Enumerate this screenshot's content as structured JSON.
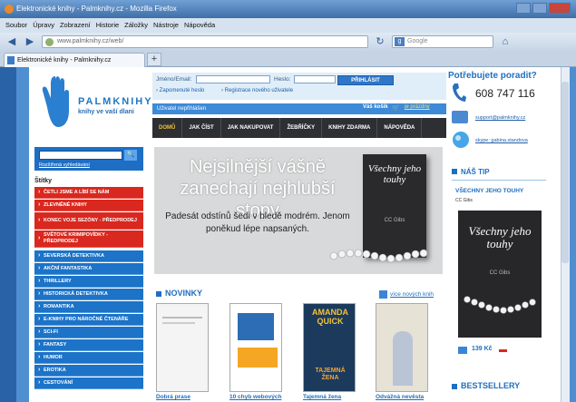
{
  "window": {
    "title": "Elektronické knihy - Palmknihy.cz - Mozilla Firefox"
  },
  "menu": [
    "Soubor",
    "Úpravy",
    "Zobrazení",
    "Historie",
    "Záložky",
    "Nástroje",
    "Nápověda"
  ],
  "navbar": {
    "url": "www.palmknihy.cz/web/",
    "search_placeholder": "Google"
  },
  "tab": {
    "label": "Elektronické knihy - Palmknihy.cz",
    "new_tab": "+"
  },
  "logo": {
    "name": "PALMKNIHY",
    "tagline": "knihy ve vaší dlani"
  },
  "login": {
    "email_label": "Jméno/Email:",
    "password_label": "Heslo:",
    "button": "PŘIHLÁSIT",
    "forgot": "Zapomenuté heslo",
    "register": "Registrace nového uživatele"
  },
  "userbar": {
    "status": "Uživatel nepřihlášen",
    "cart": "Váš košík",
    "cart_link": "je prázdný"
  },
  "nav": [
    "DOMŮ",
    "JAK ČÍST",
    "JAK NAKUPOVAT",
    "ŽEBŘÍČKY",
    "KNIHY ZDARMA",
    "NÁPOVĚDA"
  ],
  "sidebar": {
    "search_button": "🔍",
    "advanced_search": "Rozšířená vyhledávání",
    "tags_title": "Štítky",
    "categories": [
      {
        "label": "ČETLI JSME A LÍBÍ SE NÁM",
        "color": "red"
      },
      {
        "label": "ZLEVNĚNÉ KNIHY",
        "color": "red"
      },
      {
        "label": "KONEC VOJE SEZÓNY - PŘEDPRODEJ",
        "color": "red"
      },
      {
        "label": "SVĚTOVÉ KRIMIPOVÍDKY - PŘEDPRODEJ",
        "color": "red"
      },
      {
        "label": "SEVERSKÁ DETEKTIVKA",
        "color": "blue"
      },
      {
        "label": "AKČNÍ FANTASTIKA",
        "color": "blue"
      },
      {
        "label": "THRILLERY",
        "color": "blue"
      },
      {
        "label": "HISTORICKÁ DETEKTIVKA",
        "color": "blue"
      },
      {
        "label": "ROMANTIKA",
        "color": "blue"
      },
      {
        "label": "E-KNIHY PRO NÁROČNÉ ČTENÁŘE",
        "color": "blue"
      },
      {
        "label": "SCI-FI",
        "color": "blue"
      },
      {
        "label": "FANTASY",
        "color": "blue"
      },
      {
        "label": "HUMOR",
        "color": "blue"
      },
      {
        "label": "EROTIKA",
        "color": "blue"
      },
      {
        "label": "CESTOVÁNÍ",
        "color": "blue"
      }
    ]
  },
  "banner": {
    "headline": "Nejsilnější vášně zanechají nejhlubší stopy",
    "subtitle": "Padesát odstínů šedi v bledě modrém. Jenom poněkud lépe napsaných.",
    "book_title": "Všechny jeho touhy",
    "book_author": "CC Gibs"
  },
  "novinky": {
    "title": "NOVINKY",
    "more": "více nových knih",
    "books": [
      {
        "title": "Dobrá prase"
      },
      {
        "title": "10 chyb webových"
      },
      {
        "title": "Tajemná žena",
        "cover_top": "AMANDA QUICK",
        "cover_bottom": "TAJEMNÁ ŽENA"
      },
      {
        "title": "Odvážná nevěsta"
      }
    ]
  },
  "help": {
    "title": "Potřebujete poradit?",
    "phone": "608 747 116",
    "email": "support@palmknihy.cz",
    "skype": "skype: gabina.standova"
  },
  "tip": {
    "title": "NÁŠ TIP",
    "book_title": "VŠECHNY JEHO TOUHY",
    "author": "CC Gibs",
    "cover_title": "Všechny jeho touhy",
    "cover_author": "CC Gibs",
    "price": "139 Kč"
  },
  "bestsellery": {
    "title": "BESTSELLERY"
  }
}
